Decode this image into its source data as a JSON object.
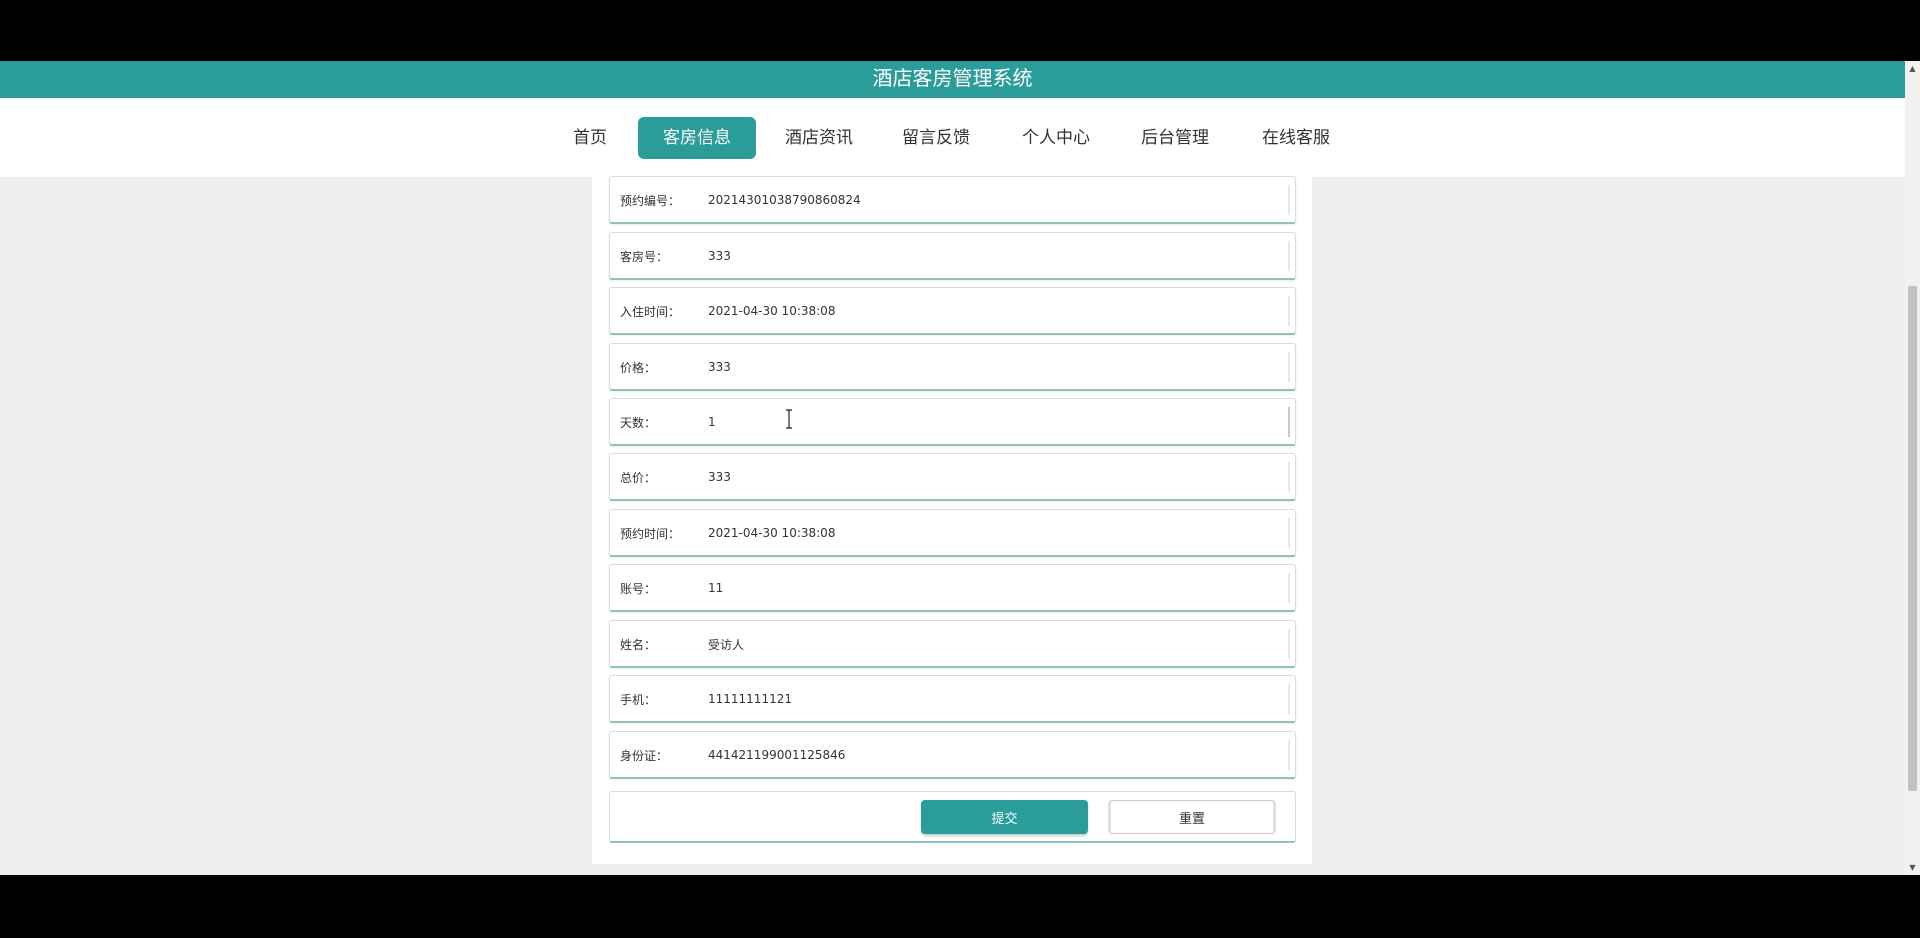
{
  "header": {
    "title": "酒店客房管理系统"
  },
  "nav": {
    "items": [
      {
        "label": "首页"
      },
      {
        "label": "客房信息"
      },
      {
        "label": "酒店资讯"
      },
      {
        "label": "留言反馈"
      },
      {
        "label": "个人中心"
      },
      {
        "label": "后台管理"
      },
      {
        "label": "在线客服"
      }
    ],
    "active_index": 1
  },
  "form": {
    "fields": [
      {
        "label": "预约编号：",
        "value": "20214301038790860824"
      },
      {
        "label": "客房号：",
        "value": "333"
      },
      {
        "label": "入住时间：",
        "value": "2021-04-30 10:38:08"
      },
      {
        "label": "价格：",
        "value": "333"
      },
      {
        "label": "天数：",
        "value": "1"
      },
      {
        "label": "总价：",
        "value": "333"
      },
      {
        "label": "预约时间：",
        "value": "2021-04-30 10:38:08"
      },
      {
        "label": "账号：",
        "value": "11"
      },
      {
        "label": "姓名：",
        "value": "受访人"
      },
      {
        "label": "手机：",
        "value": "11111111121"
      },
      {
        "label": "身份证：",
        "value": "441421199001125846"
      }
    ],
    "submit_label": "提交",
    "reset_label": "重置"
  },
  "colors": {
    "accent": "#2a9d9a",
    "background": "#efefef"
  }
}
